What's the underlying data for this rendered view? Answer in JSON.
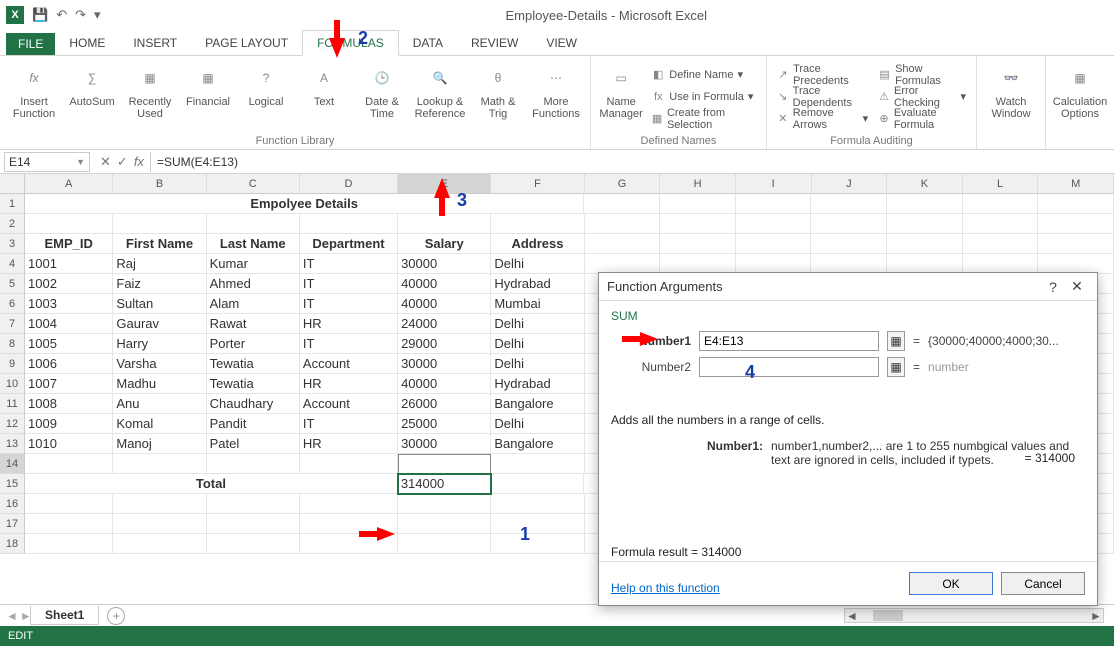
{
  "titlebar": {
    "title": "Employee-Details - Microsoft Excel"
  },
  "tabs": {
    "file": "FILE",
    "home": "HOME",
    "insert": "INSERT",
    "pagelayout": "PAGE LAYOUT",
    "formulas": "FORMULAS",
    "data": "DATA",
    "review": "REVIEW",
    "view": "VIEW"
  },
  "ribbon": {
    "g1": {
      "insertfn": "Insert\nFunction",
      "autosum": "AutoSum",
      "recent": "Recently\nUsed",
      "financial": "Financial",
      "logical": "Logical",
      "text": "Text",
      "datetime": "Date &\nTime",
      "lookup": "Lookup &\nReference",
      "math": "Math &\nTrig",
      "more": "More\nFunctions",
      "label": "Function Library"
    },
    "g2": {
      "namemgr": "Name\nManager",
      "define": "Define Name",
      "usein": "Use in Formula",
      "createsel": "Create from Selection",
      "label": "Defined Names"
    },
    "g3": {
      "traceprec": "Trace Precedents",
      "tracedep": "Trace Dependents",
      "removearr": "Remove Arrows",
      "showfm": "Show Formulas",
      "errchk": "Error Checking",
      "evalfm": "Evaluate Formula",
      "label": "Formula Auditing"
    },
    "g4": {
      "watch": "Watch\nWindow"
    },
    "g5": {
      "calcopt": "Calculation\nOptions"
    }
  },
  "fbar": {
    "namebox": "E14",
    "formula": "=SUM(E4:E13)"
  },
  "cols": [
    "A",
    "B",
    "C",
    "D",
    "E",
    "F",
    "G",
    "H",
    "I",
    "J",
    "K",
    "L",
    "M"
  ],
  "title_cell": "Empolyee Details",
  "headers": {
    "a": "EMP_ID",
    "b": "First Name",
    "c": "Last Name",
    "d": "Department",
    "e": "Salary",
    "f": "Address"
  },
  "rows": [
    {
      "id": "1001",
      "fn": "Raj",
      "ln": "Kumar",
      "dep": "IT",
      "sal": "30000",
      "addr": "Delhi"
    },
    {
      "id": "1002",
      "fn": "Faiz",
      "ln": "Ahmed",
      "dep": "IT",
      "sal": "40000",
      "addr": "Hydrabad"
    },
    {
      "id": "1003",
      "fn": "Sultan",
      "ln": "Alam",
      "dep": "IT",
      "sal": "40000",
      "addr": "Mumbai"
    },
    {
      "id": "1004",
      "fn": "Gaurav",
      "ln": "Rawat",
      "dep": "HR",
      "sal": "24000",
      "addr": "Delhi"
    },
    {
      "id": "1005",
      "fn": "Harry",
      "ln": "Porter",
      "dep": "IT",
      "sal": "29000",
      "addr": "Delhi"
    },
    {
      "id": "1006",
      "fn": "Varsha",
      "ln": "Tewatia",
      "dep": "Account",
      "sal": "30000",
      "addr": "Delhi"
    },
    {
      "id": "1007",
      "fn": "Madhu",
      "ln": "Tewatia",
      "dep": "HR",
      "sal": "40000",
      "addr": "Hydrabad"
    },
    {
      "id": "1008",
      "fn": "Anu",
      "ln": "Chaudhary",
      "dep": "Account",
      "sal": "26000",
      "addr": "Bangalore"
    },
    {
      "id": "1009",
      "fn": "Komal",
      "ln": "Pandit",
      "dep": "IT",
      "sal": "25000",
      "addr": "Delhi"
    },
    {
      "id": "1010",
      "fn": "Manoj",
      "ln": "Patel",
      "dep": "HR",
      "sal": "30000",
      "addr": "Bangalore"
    }
  ],
  "total_label": "Total",
  "total_value": "314000",
  "sheettab": "Sheet1",
  "statusbar": "EDIT",
  "dialog": {
    "title": "Function Arguments",
    "func": "SUM",
    "arg1_label": "Number1",
    "arg1_val": "E4:E13",
    "arg1_res": "{30000;40000;4000;30...",
    "arg2_label": "Number2",
    "arg2_val": "",
    "arg2_res": "number",
    "result_eq": "=   314000",
    "desc": "Adds all the numbers in a range of cells.",
    "argdesc_k": "Number1:",
    "argdesc_v": "number1,number2,... are 1 to 255 numbgical values and text are ignored in cells, included if typets.",
    "formula_result_label": "Formula result =   314000",
    "help": "Help on this function",
    "ok": "OK",
    "cancel": "Cancel"
  },
  "annotations": {
    "n1": "1",
    "n2": "2",
    "n3": "3",
    "n4": "4"
  }
}
